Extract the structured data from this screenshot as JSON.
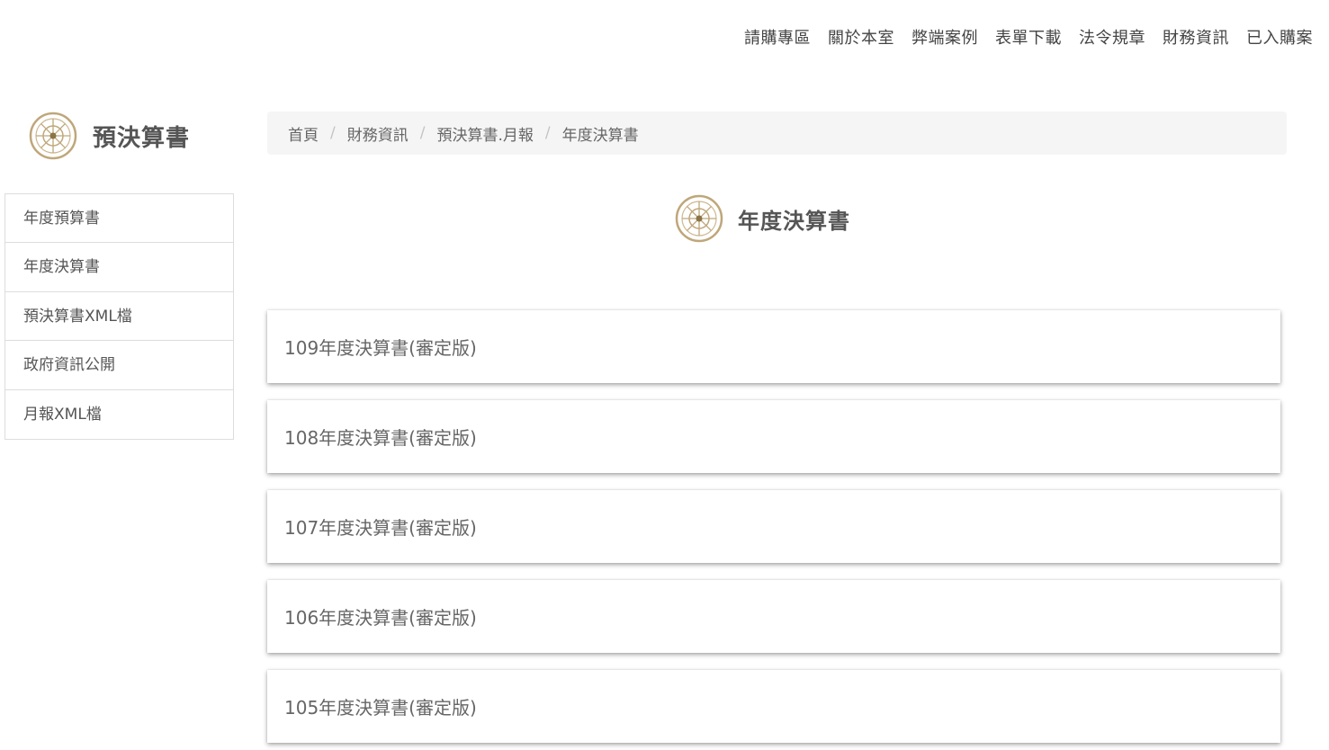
{
  "topnav": {
    "items": [
      "請購專區",
      "關於本室",
      "弊端案例",
      "表單下載",
      "法令規章",
      "財務資訊",
      "已入購案"
    ]
  },
  "sidebar": {
    "heading": "預決算書",
    "items": [
      "年度預算書",
      "年度決算書",
      "預決算書XML檔",
      "政府資訊公開",
      "月報XML檔"
    ]
  },
  "breadcrumb": {
    "items": [
      "首頁",
      "財務資訊",
      "預決算書.月報",
      "年度決算書"
    ],
    "separator": "/"
  },
  "main": {
    "title": "年度決算書",
    "documents": [
      "109年度決算書(審定版)",
      "108年度決算書(審定版)",
      "107年度決算書(審定版)",
      "106年度決算書(審定版)",
      "105年度決算書(審定版)"
    ]
  },
  "colors": {
    "accent_gold": "#bfa77a",
    "text": "#555555",
    "breadcrumb_bg": "#f5f5f5",
    "border": "#dddddd"
  },
  "icons": {
    "emblem": "dharma-wheel-emblem-icon"
  }
}
